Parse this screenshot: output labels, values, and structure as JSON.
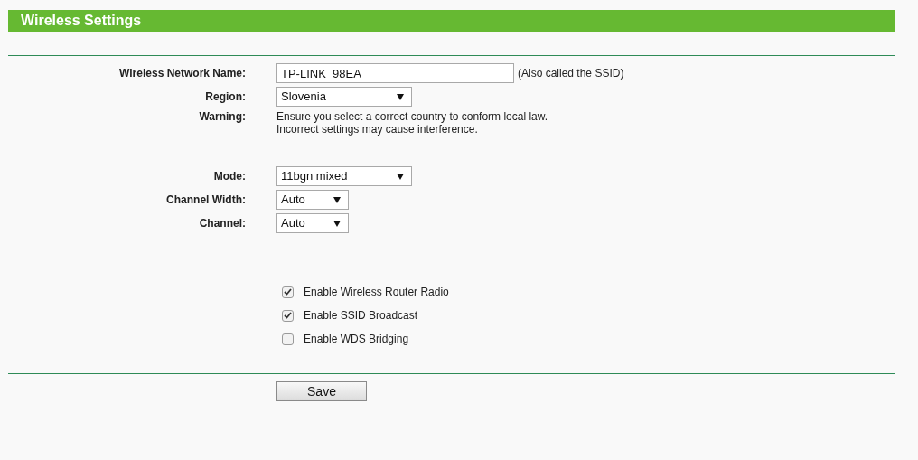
{
  "title": "Wireless Settings",
  "network_name": {
    "label": "Wireless Network Name:",
    "value": "TP-LINK_98EA",
    "note": "(Also called the SSID)"
  },
  "region": {
    "label": "Region:",
    "value": "Slovenia"
  },
  "warning": {
    "label": "Warning:",
    "lines": [
      "Ensure you select a correct country to conform local law.",
      "Incorrect settings may cause interference."
    ]
  },
  "selects": [
    {
      "label": "Mode:",
      "value": "11bgn mixed",
      "wide": true
    },
    {
      "label": "Channel Width:",
      "value": "Auto",
      "wide": false
    },
    {
      "label": "Channel:",
      "value": "Auto",
      "wide": false
    }
  ],
  "options": [
    {
      "label": "Enable Wireless Router Radio",
      "checked": true
    },
    {
      "label": "Enable SSID Broadcast",
      "checked": true
    },
    {
      "label": "Enable WDS Bridging",
      "checked": false
    }
  ],
  "save_button": "Save"
}
